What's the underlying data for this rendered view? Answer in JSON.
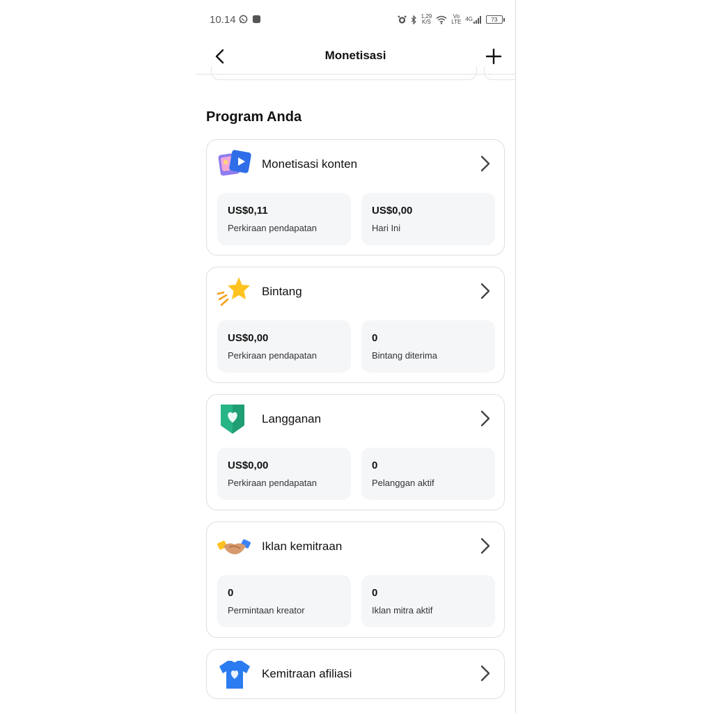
{
  "status_bar": {
    "time": "10.14",
    "speed_top": "1,29",
    "speed_bottom": "K/S",
    "volte_top": "Vo",
    "volte_bottom": "LTE",
    "network": "4G",
    "battery": "73"
  },
  "header": {
    "title": "Monetisasi"
  },
  "section_title": "Program Anda",
  "cards": [
    {
      "title": "Monetisasi konten",
      "icon": "content-monetization-icon",
      "stats": [
        {
          "value": "US$0,11",
          "label": "Perkiraan pendapatan"
        },
        {
          "value": "US$0,00",
          "label": "Hari Ini"
        }
      ]
    },
    {
      "title": "Bintang",
      "icon": "star-icon",
      "stats": [
        {
          "value": "US$0,00",
          "label": "Perkiraan pendapatan"
        },
        {
          "value": "0",
          "label": "Bintang diterima"
        }
      ]
    },
    {
      "title": "Langganan",
      "icon": "heart-badge-icon",
      "stats": [
        {
          "value": "US$0,00",
          "label": "Perkiraan pendapatan"
        },
        {
          "value": "0",
          "label": "Pelanggan aktif"
        }
      ]
    },
    {
      "title": "Iklan kemitraan",
      "icon": "handshake-icon",
      "stats": [
        {
          "value": "0",
          "label": "Permintaan kreator"
        },
        {
          "value": "0",
          "label": "Iklan mitra aktif"
        }
      ]
    },
    {
      "title": "Kemitraan afiliasi",
      "icon": "tshirt-icon"
    }
  ],
  "colors": {
    "card_border": "#dcdfe4",
    "stat_bg": "#f5f6f8",
    "text": "#111111"
  }
}
